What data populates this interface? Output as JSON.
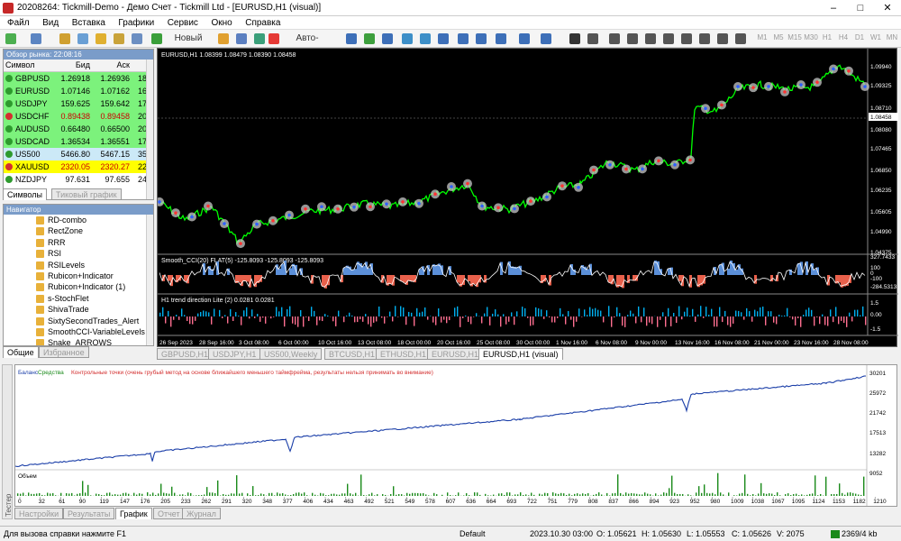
{
  "window": {
    "title": "20208264: Tickmill-Demo - Демо Счет - Tickmill Ltd - [EURUSD,H1 (visual)]",
    "minimize": "–",
    "maximize": "□",
    "close": "✕"
  },
  "menu": [
    "Файл",
    "Вид",
    "Вставка",
    "Графики",
    "Сервис",
    "Окно",
    "Справка"
  ],
  "toolbar": {
    "new_order": "Новый ордер",
    "autotrading": "Авто-торговля",
    "timeframes": [
      "M1",
      "M5",
      "M15",
      "M30",
      "H1",
      "H4",
      "D1",
      "W1",
      "MN"
    ]
  },
  "market_watch": {
    "title": "Обзор рынка: 22:08:16",
    "headers": {
      "symbol": "Символ",
      "bid": "Бид",
      "ask": "Аск",
      "spread": "!"
    },
    "rows": [
      {
        "symbol": "GBPUSD",
        "bid": "1.26918",
        "ask": "1.26936",
        "spread": "18",
        "bg": "#7cf27c",
        "arrow": "#2e9a2e"
      },
      {
        "symbol": "EURUSD",
        "bid": "1.07146",
        "ask": "1.07162",
        "spread": "16",
        "bg": "#7cf27c",
        "arrow": "#2e9a2e"
      },
      {
        "symbol": "USDJPY",
        "bid": "159.625",
        "ask": "159.642",
        "spread": "17",
        "bg": "#7cf27c",
        "arrow": "#2e9a2e"
      },
      {
        "symbol": "USDCHF",
        "bid": "0.89438",
        "ask": "0.89458",
        "spread": "20",
        "bg": "#7cf27c",
        "arrow": "#d32f2f"
      },
      {
        "symbol": "AUDUSD",
        "bid": "0.66480",
        "ask": "0.66500",
        "spread": "20",
        "bg": "#7cf27c",
        "arrow": "#2e9a2e"
      },
      {
        "symbol": "USDCAD",
        "bid": "1.36534",
        "ask": "1.36551",
        "spread": "17",
        "bg": "#7cf27c",
        "arrow": "#2e9a2e"
      },
      {
        "symbol": "US500",
        "bid": "5466.80",
        "ask": "5467.15",
        "spread": "35",
        "bg": "#cce9f7",
        "arrow": "#2e9a2e"
      },
      {
        "symbol": "XAUUSD",
        "bid": "2320.05",
        "ask": "2320.27",
        "spread": "22",
        "bg": "#ffff00",
        "arrow": "#d32f2f"
      },
      {
        "symbol": "NZDJPY",
        "bid": "97.631",
        "ask": "97.655",
        "spread": "24",
        "bg": "#ffffff",
        "arrow": "#2e9a2e"
      }
    ],
    "tabs": [
      "Символы",
      "Тиковый график"
    ]
  },
  "navigator": {
    "title": "Навигатор",
    "items": [
      "RD-combo",
      "RectZone",
      "RRR",
      "RSI",
      "RSILevels",
      "Rubicon+Indicator",
      "Rubicon+Indicator (1)",
      "s-StochFlet",
      "ShivaTrade",
      "SixtySecondTrades_Alert",
      "SmoothCCI-VariableLevels A",
      "Snake_ARROWS"
    ],
    "tabs": [
      "Общие",
      "Избранное"
    ]
  },
  "chart": {
    "info": "EURUSD,H1  1.08399 1.08479 1.08390 1.08458",
    "price_labels": [
      "1.09940",
      "1.09325",
      "1.08710",
      "1.08458",
      "1.08080",
      "1.07465",
      "1.06850",
      "1.06235",
      "1.05605",
      "1.04990",
      "1.04375"
    ],
    "current_price": "1.08458",
    "cci_label": "Smooth_CCI(20) FLAT(5) -125.8093 -125.8093 -125.8093",
    "cci_scale": [
      "327.7433",
      "100",
      "0",
      "-100",
      "-284.5313"
    ],
    "trend_label": "H1 trend direction Lite (2) 0.0281 0.0281",
    "trend_scale": [
      "1.5",
      "0.00",
      "-1.5"
    ],
    "time_labels": [
      "26 Sep 2023",
      "28 Sep 16:00",
      "3 Oct 08:00",
      "6 Oct 00:00",
      "10 Oct 16:00",
      "13 Oct 08:00",
      "18 Oct 00:00",
      "20 Oct 16:00",
      "25 Oct 08:00",
      "30 Oct 00:00",
      "1 Nov 16:00",
      "6 Nov 08:00",
      "9 Nov 00:00",
      "13 Nov 16:00",
      "16 Nov 08:00",
      "21 Nov 00:00",
      "23 Nov 16:00",
      "28 Nov 08:00"
    ],
    "tabs": [
      "GBPUSD,H1",
      "USDJPY,H1",
      "US500,Weekly",
      "BTCUSD,H1",
      "ETHUSD,H1",
      "EURUSD,H1",
      "EURUSD,H1 (visual)"
    ],
    "colors": {
      "up": "#00ff00",
      "down": "#ff3333",
      "cci_pos": "#5b8fd8",
      "cci_neg": "#e8604b",
      "trend_pos": "#00b0f0",
      "trend_neg": "#ff6f90"
    }
  },
  "tester": {
    "legend_balance": "Баланс",
    "legend_equity": "Средства",
    "legend_note": "Контрольные точки (очень грубый метод на основе ближайшего меньшего таймфрейма, результаты нельзя принимать во внимание)",
    "y_labels": [
      "30201",
      "25972",
      "21742",
      "17513",
      "13282",
      "9052"
    ],
    "volume_label": "Объем",
    "x_labels": [
      "0",
      "32",
      "61",
      "90",
      "119",
      "147",
      "176",
      "205",
      "233",
      "262",
      "291",
      "320",
      "348",
      "377",
      "406",
      "434",
      "463",
      "492",
      "521",
      "549",
      "578",
      "607",
      "636",
      "664",
      "693",
      "722",
      "751",
      "779",
      "808",
      "837",
      "866",
      "894",
      "923",
      "952",
      "980",
      "1009",
      "1038",
      "1067",
      "1095",
      "1124",
      "1153",
      "1182",
      "1210"
    ],
    "tabs": [
      "Настройки",
      "Результаты",
      "График",
      "Отчет",
      "Журнал"
    ],
    "side_label": "Тестер"
  },
  "status": {
    "help": "Для вызова справки нажмите F1",
    "profile": "Default",
    "datetime": "2023.10.30 03:00",
    "open": "O: 1.05621",
    "high": "H: 1.05630",
    "low": "L: 1.05553",
    "close": "C: 1.05626",
    "volume": "V: 2075",
    "traffic": "2369/4 kb"
  }
}
